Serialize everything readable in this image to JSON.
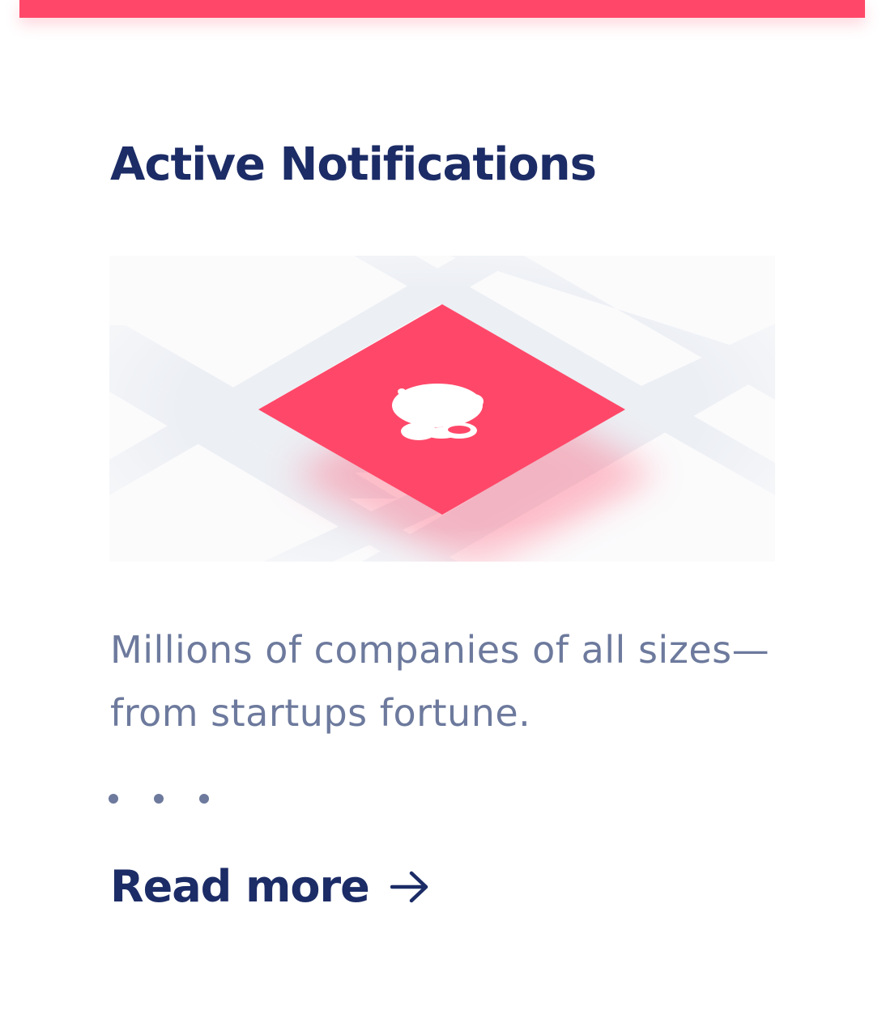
{
  "card": {
    "title": "Active Notifications",
    "description": "Millions of companies of all sizes—from startups fortune.",
    "read_more_label": "Read more",
    "illustration_icon": "notification-bell-icon",
    "arrow_icon": "arrow-right-icon",
    "pager_dots": 3
  },
  "colors": {
    "accent": "#ff4869",
    "title": "#1c2c66",
    "body_text": "#6d7a9d",
    "illustration_bg": "#fbfbfc",
    "grid_lines": "#eceff4"
  }
}
